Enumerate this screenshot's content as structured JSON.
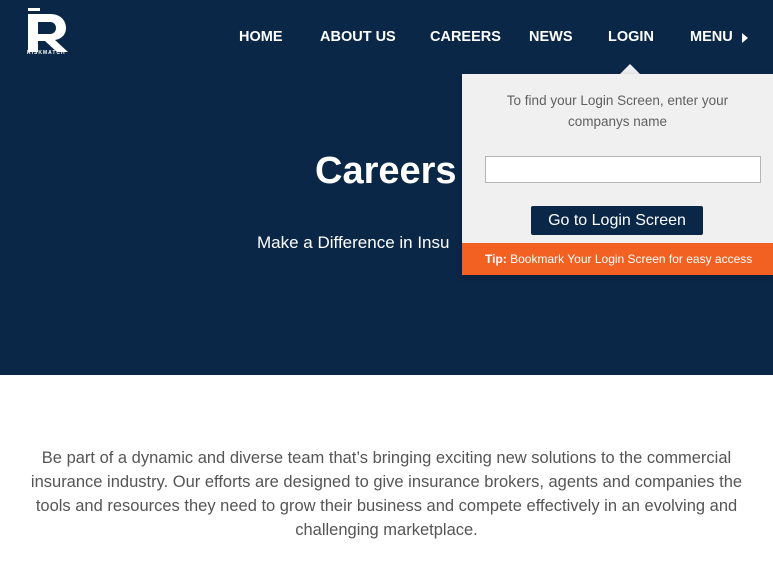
{
  "brand": {
    "letter": "R",
    "sub": "RISKMATCH"
  },
  "nav": {
    "home": "HOME",
    "about": "ABOUT US",
    "careers": "CAREERS",
    "news": "NEWS",
    "login": "LOGIN",
    "menu": "MENU"
  },
  "hero": {
    "title": "Careers",
    "subtitle": "Make a Difference in Insu"
  },
  "intro": "Be part of a dynamic and diverse team that’s bringing exciting new solutions to the commercial insurance industry. Our efforts are designed to give insurance brokers, agents and companies the tools and resources they need to grow their business and compete effectively in an evolving and challenging marketplace.",
  "login_dropdown": {
    "instruction": "To find your Login Screen, enter your companys name",
    "company_value": "",
    "button": "Go to Login Screen",
    "tip_label": "Tip:",
    "tip_text": "Bookmark Your Login Screen for easy access"
  },
  "colors": {
    "navy": "#0b2748",
    "orange": "#f26122",
    "panel": "#f0f0f0"
  }
}
